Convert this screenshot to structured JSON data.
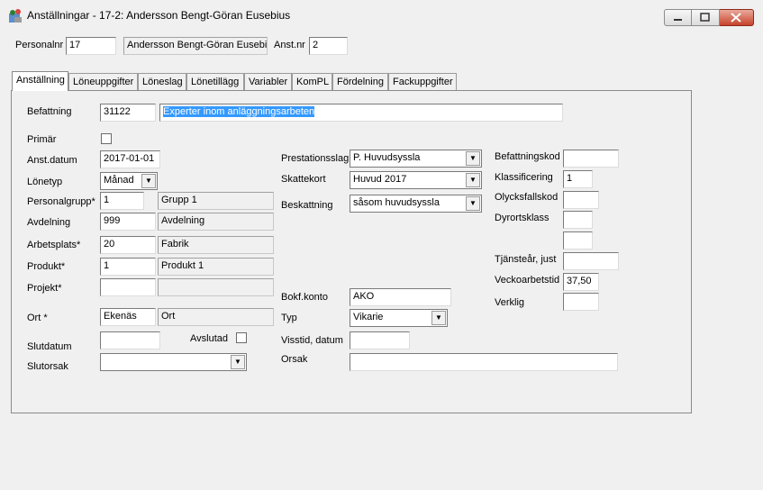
{
  "window": {
    "title": "Anställningar - 17-2: Andersson Bengt-Göran Eusebius"
  },
  "header": {
    "personalnr_label": "Personalnr",
    "personalnr_value": "17",
    "name_value": "Andersson Bengt-Göran Eusebius",
    "anstnr_label": "Anst.nr",
    "anstnr_value": "2"
  },
  "tabs": [
    {
      "label": "Anställning"
    },
    {
      "label": "Löneuppgifter"
    },
    {
      "label": "Löneslag"
    },
    {
      "label": "Lönetillägg"
    },
    {
      "label": "Variabler"
    },
    {
      "label": "KomPL"
    },
    {
      "label": "Fördelning"
    },
    {
      "label": "Fackuppgifter"
    }
  ],
  "form": {
    "befattning_label": "Befattning",
    "befattning_code": "31122",
    "befattning_text": "Experter inom anläggningsarbeten",
    "primar_label": "Primär",
    "anstdatum_label": "Anst.datum",
    "anstdatum_value": "2017-01-01",
    "lonetyp_label": "Lönetyp",
    "lonetyp_value": "Månad",
    "personalgrupp_label": "Personalgrupp*",
    "personalgrupp_value": "1",
    "personalgrupp_text": "Grupp 1",
    "avdelning_label": "Avdelning",
    "avdelning_value": "999",
    "avdelning_text": "Avdelning",
    "arbetsplats_label": "Arbetsplats*",
    "arbetsplats_value": "20",
    "arbetsplats_text": "Fabrik",
    "produkt_label": "Produkt*",
    "produkt_value": "1",
    "produkt_text": "Produkt 1",
    "projekt_label": "Projekt*",
    "ort_label": "Ort *",
    "ort_value": "Ekenäs",
    "ort_text": "Ort",
    "slutdatum_label": "Slutdatum",
    "avslutad_label": "Avslutad",
    "slutorsak_label": "Slutorsak",
    "prestationsslag_label": "Prestationsslag",
    "prestationsslag_value": "P. Huvudsyssla",
    "skattekort_label": "Skattekort",
    "skattekort_value": "Huvud 2017",
    "beskattning_label": "Beskattning",
    "beskattning_value": "såsom huvudsyssla",
    "bokfkonto_label": "Bokf.konto",
    "bokfkonto_value": "AKO",
    "typ_label": "Typ",
    "typ_value": "Vikarie",
    "visstid_label": "Visstid, datum",
    "orsak_label": "Orsak",
    "befattningskod_label": "Befattningskod",
    "klassificering_label": "Klassificering",
    "klassificering_value": "1",
    "olycksfallskod_label": "Olycksfallskod",
    "dyrortsklass_label": "Dyrortsklass",
    "tjansteår_label": "Tjänsteår, just",
    "veckoarbetstid_label": "Veckoarbetstid",
    "veckoarbetstid_value": "37,50",
    "verklig_label": "Verklig"
  }
}
